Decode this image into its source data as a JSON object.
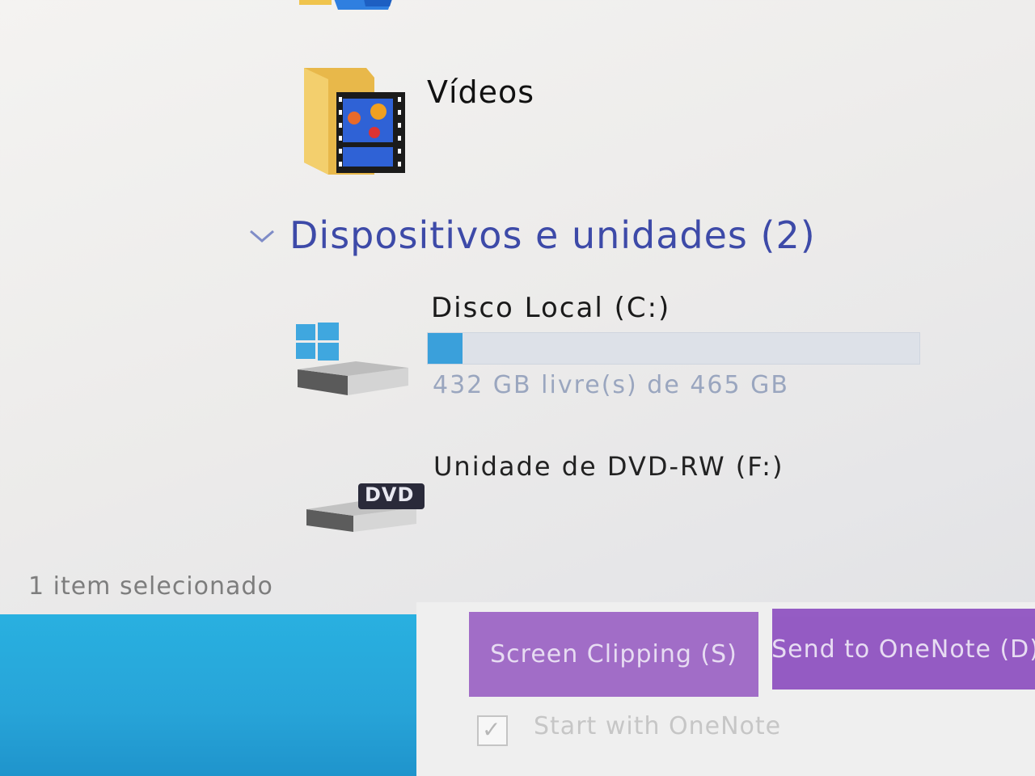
{
  "folders": {
    "videos": {
      "label": "Vídeos",
      "icon": "videos-folder-icon"
    }
  },
  "devices_group": {
    "title": "Dispositivos e unidades (2)",
    "chevron_icon": "chevron-down-icon"
  },
  "drives": {
    "local_disk": {
      "label": "Disco Local (C:)",
      "free_text": "432 GB livre(s) de 465 GB",
      "used_fraction": 0.071,
      "icon": "local-disk-icon",
      "bar_color": "#3aa0db"
    },
    "dvd": {
      "label": "Unidade de DVD-RW (F:)",
      "icon": "dvd-drive-icon",
      "badge": "DVD"
    }
  },
  "status_bar": {
    "text": "1 item selecionado"
  },
  "onenote": {
    "screen_clipping_label": "Screen Clipping (S)",
    "send_to_onenote_label": "Send to OneNote (D)",
    "startup_label": "Start with OneNote",
    "startup_checked": true,
    "accent_color": "#9b62c4"
  }
}
